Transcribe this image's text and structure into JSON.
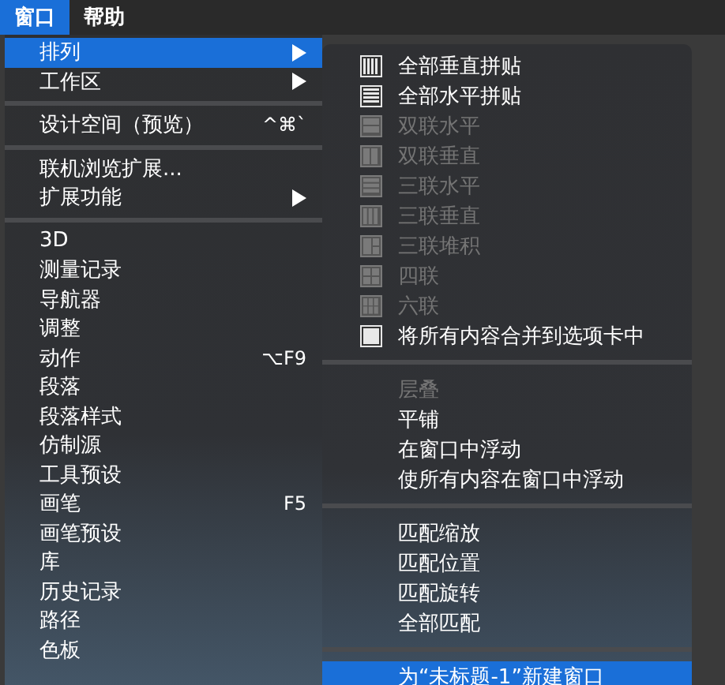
{
  "menubar": [
    {
      "label": "窗口",
      "selected": true
    },
    {
      "label": "帮助",
      "selected": false
    }
  ],
  "menu": [
    {
      "kind": "item",
      "label": "排列",
      "selected": true,
      "submenu": true
    },
    {
      "kind": "item",
      "label": "工作区",
      "selected": false,
      "submenu": true
    },
    {
      "kind": "separator"
    },
    {
      "kind": "item",
      "label": "设计空间（预览）",
      "selected": false,
      "shortcut": "^⌘`"
    },
    {
      "kind": "separator"
    },
    {
      "kind": "item",
      "label": "联机浏览扩展...",
      "selected": false
    },
    {
      "kind": "item",
      "label": "扩展功能",
      "selected": false,
      "submenu": true
    },
    {
      "kind": "separator"
    },
    {
      "kind": "item",
      "label": "3D",
      "selected": false
    },
    {
      "kind": "item",
      "label": "测量记录",
      "selected": false
    },
    {
      "kind": "item",
      "label": "导航器",
      "selected": false
    },
    {
      "kind": "item",
      "label": "调整",
      "selected": false
    },
    {
      "kind": "item",
      "label": "动作",
      "selected": false,
      "shortcut": "⌥F9"
    },
    {
      "kind": "item",
      "label": "段落",
      "selected": false
    },
    {
      "kind": "item",
      "label": "段落样式",
      "selected": false
    },
    {
      "kind": "item",
      "label": "仿制源",
      "selected": false
    },
    {
      "kind": "item",
      "label": "工具预设",
      "selected": false
    },
    {
      "kind": "item",
      "label": "画笔",
      "selected": false,
      "shortcut": "F5"
    },
    {
      "kind": "item",
      "label": "画笔预设",
      "selected": false
    },
    {
      "kind": "item",
      "label": "库",
      "selected": false
    },
    {
      "kind": "item",
      "label": "历史记录",
      "selected": false
    },
    {
      "kind": "item",
      "label": "路径",
      "selected": false
    },
    {
      "kind": "item",
      "label": "色板",
      "selected": false
    }
  ],
  "submenu": [
    {
      "kind": "tile",
      "label": "全部垂直拼贴",
      "disabled": false,
      "selected": false
    },
    {
      "kind": "tile",
      "label": "全部水平拼贴",
      "disabled": false,
      "selected": false
    },
    {
      "kind": "tile",
      "label": "双联水平",
      "disabled": true,
      "selected": false
    },
    {
      "kind": "tile",
      "label": "双联垂直",
      "disabled": true,
      "selected": false
    },
    {
      "kind": "tile",
      "label": "三联水平",
      "disabled": true,
      "selected": false
    },
    {
      "kind": "tile",
      "label": "三联垂直",
      "disabled": true,
      "selected": false
    },
    {
      "kind": "tile",
      "label": "三联堆积",
      "disabled": true,
      "selected": false
    },
    {
      "kind": "tile",
      "label": "四联",
      "disabled": true,
      "selected": false
    },
    {
      "kind": "tile",
      "label": "六联",
      "disabled": true,
      "selected": false
    },
    {
      "kind": "tile",
      "label": "将所有内容合并到选项卡中",
      "disabled": false,
      "selected": false
    },
    {
      "kind": "separator"
    },
    {
      "kind": "item",
      "label": "层叠",
      "disabled": true,
      "selected": false
    },
    {
      "kind": "item",
      "label": "平铺",
      "disabled": false,
      "selected": false
    },
    {
      "kind": "item",
      "label": "在窗口中浮动",
      "disabled": false,
      "selected": false
    },
    {
      "kind": "item",
      "label": "使所有内容在窗口中浮动",
      "disabled": false,
      "selected": false
    },
    {
      "kind": "separator"
    },
    {
      "kind": "item",
      "label": "匹配缩放",
      "disabled": false,
      "selected": false
    },
    {
      "kind": "item",
      "label": "匹配位置",
      "disabled": false,
      "selected": false
    },
    {
      "kind": "item",
      "label": "匹配旋转",
      "disabled": false,
      "selected": false
    },
    {
      "kind": "item",
      "label": "全部匹配",
      "disabled": false,
      "selected": false
    },
    {
      "kind": "separator"
    },
    {
      "kind": "item",
      "label": "为“未标题-1”新建窗口",
      "disabled": false,
      "selected": true
    }
  ]
}
